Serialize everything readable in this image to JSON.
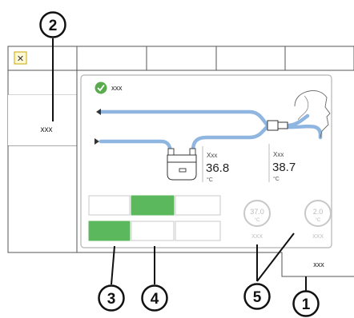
{
  "toolbar": {
    "close_glyph": "✕",
    "tab_count": 5
  },
  "sidebar": {
    "selected_label": "xxx"
  },
  "status": {
    "ok_icon": "check-circle-icon",
    "text": "xxx"
  },
  "humidifier": {
    "label": "Xxx",
    "value": "36.8",
    "unit": "°C"
  },
  "patient": {
    "label": "Xxx",
    "value": "38.7",
    "unit": "°C"
  },
  "mode_buttons": {
    "row1_active_index": 1,
    "row2_active_index": 0
  },
  "settings": [
    {
      "value": "37.0",
      "unit": "°C",
      "label": "XXX"
    },
    {
      "value": "2.0",
      "unit": "°C",
      "label": "XXX"
    }
  ],
  "corner_tab": {
    "label": "xxx"
  },
  "callouts": [
    "1",
    "2",
    "3",
    "4",
    "5"
  ],
  "colors": {
    "tube": "#8fb6e0",
    "active_green": "#5cb85c",
    "check_green": "#5aaa4e",
    "callout_stroke": "#111111",
    "inactive_gray": "#c8c8c8"
  }
}
